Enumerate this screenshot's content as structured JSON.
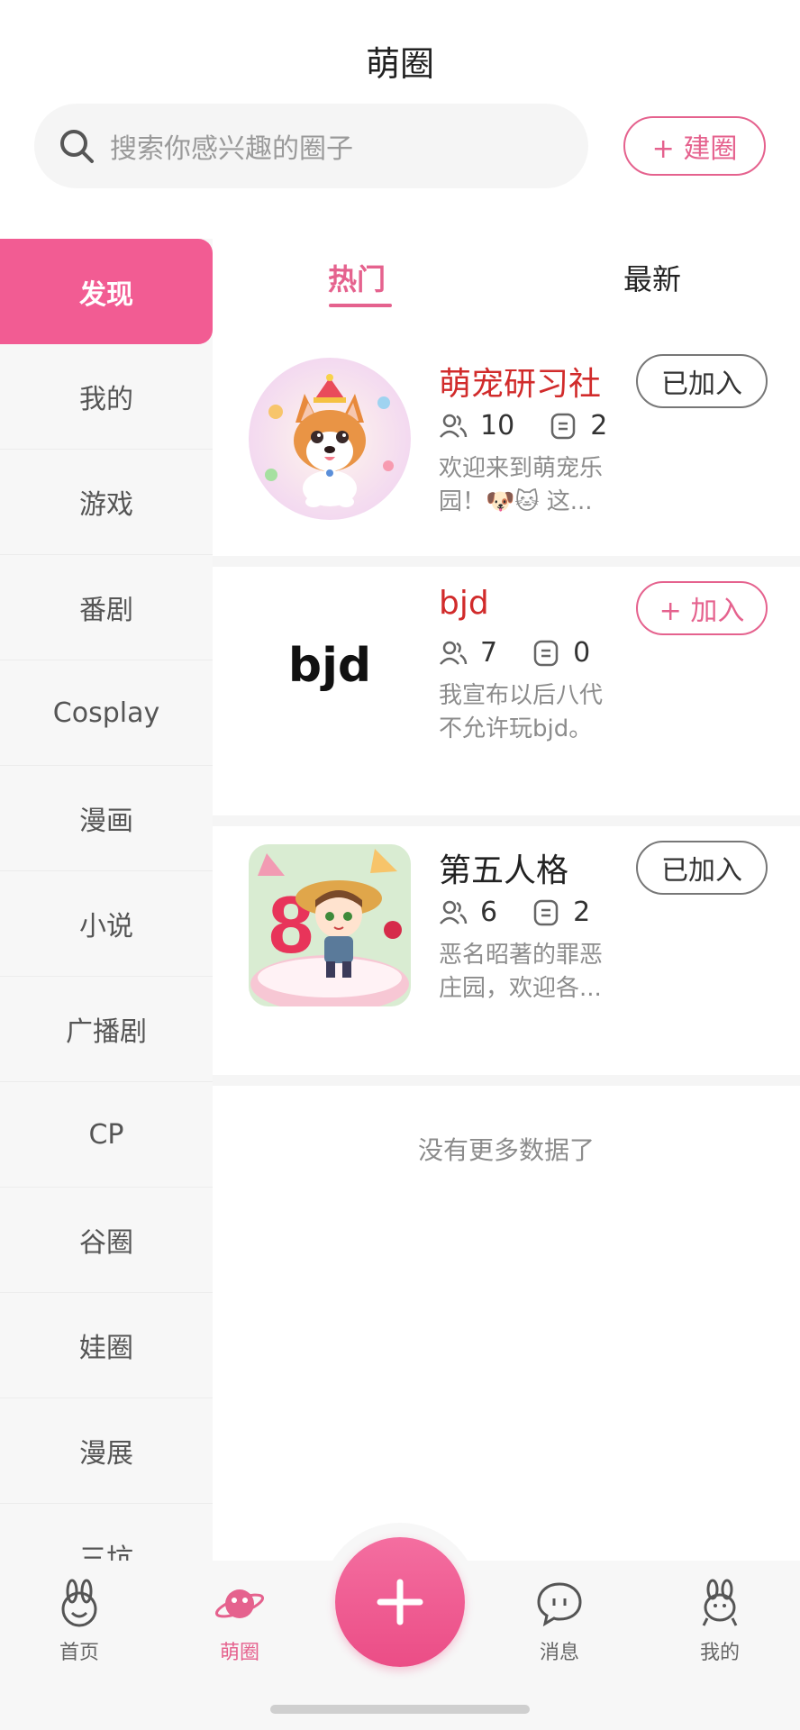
{
  "header": {
    "title": "萌圈"
  },
  "search": {
    "placeholder": "搜索你感兴趣的圈子"
  },
  "create_button": {
    "label": "+ 建圈"
  },
  "sidebar": {
    "items": [
      {
        "label": "发现",
        "active": true
      },
      {
        "label": "我的"
      },
      {
        "label": "游戏"
      },
      {
        "label": "番剧"
      },
      {
        "label": "Cosplay"
      },
      {
        "label": "漫画"
      },
      {
        "label": "小说"
      },
      {
        "label": "广播剧"
      },
      {
        "label": "CP"
      },
      {
        "label": "谷圈"
      },
      {
        "label": "娃圈"
      },
      {
        "label": "漫展"
      },
      {
        "label": "三坑"
      }
    ]
  },
  "tabs": {
    "hot": "热门",
    "new": "最新",
    "active": "hot"
  },
  "circles": [
    {
      "name": "萌宠研习社",
      "members": "10",
      "posts": "2",
      "description": "欢迎来到萌宠乐园！🐶🐱 这...",
      "join_label": "已加入",
      "joined": true,
      "avatar": "corgi-illustration"
    },
    {
      "name": "bjd",
      "members": "7",
      "posts": "0",
      "description": "我宣布以后八代不允许玩bjd。",
      "join_label": "+ 加入",
      "joined": false,
      "avatar_text": "bjd"
    },
    {
      "name": "第五人格",
      "members": "6",
      "posts": "2",
      "description": "恶名昭著的罪恶庄园，欢迎各...",
      "join_label": "已加入",
      "joined": true,
      "avatar": "anime-girl-cake-illustration"
    }
  ],
  "no_more": "没有更多数据了",
  "tabbar": {
    "items": [
      {
        "label": "首页",
        "icon": "rabbit-face-icon"
      },
      {
        "label": "萌圈",
        "icon": "planet-icon",
        "active": true
      },
      {
        "label": "",
        "icon": "plus-icon"
      },
      {
        "label": "消息",
        "icon": "chat-bubble-icon"
      },
      {
        "label": "我的",
        "icon": "rabbit-profile-icon"
      }
    ]
  },
  "colors": {
    "accent": "#e5628e",
    "sidebar_active": "#f25c93",
    "name_red": "#d12b2b"
  }
}
